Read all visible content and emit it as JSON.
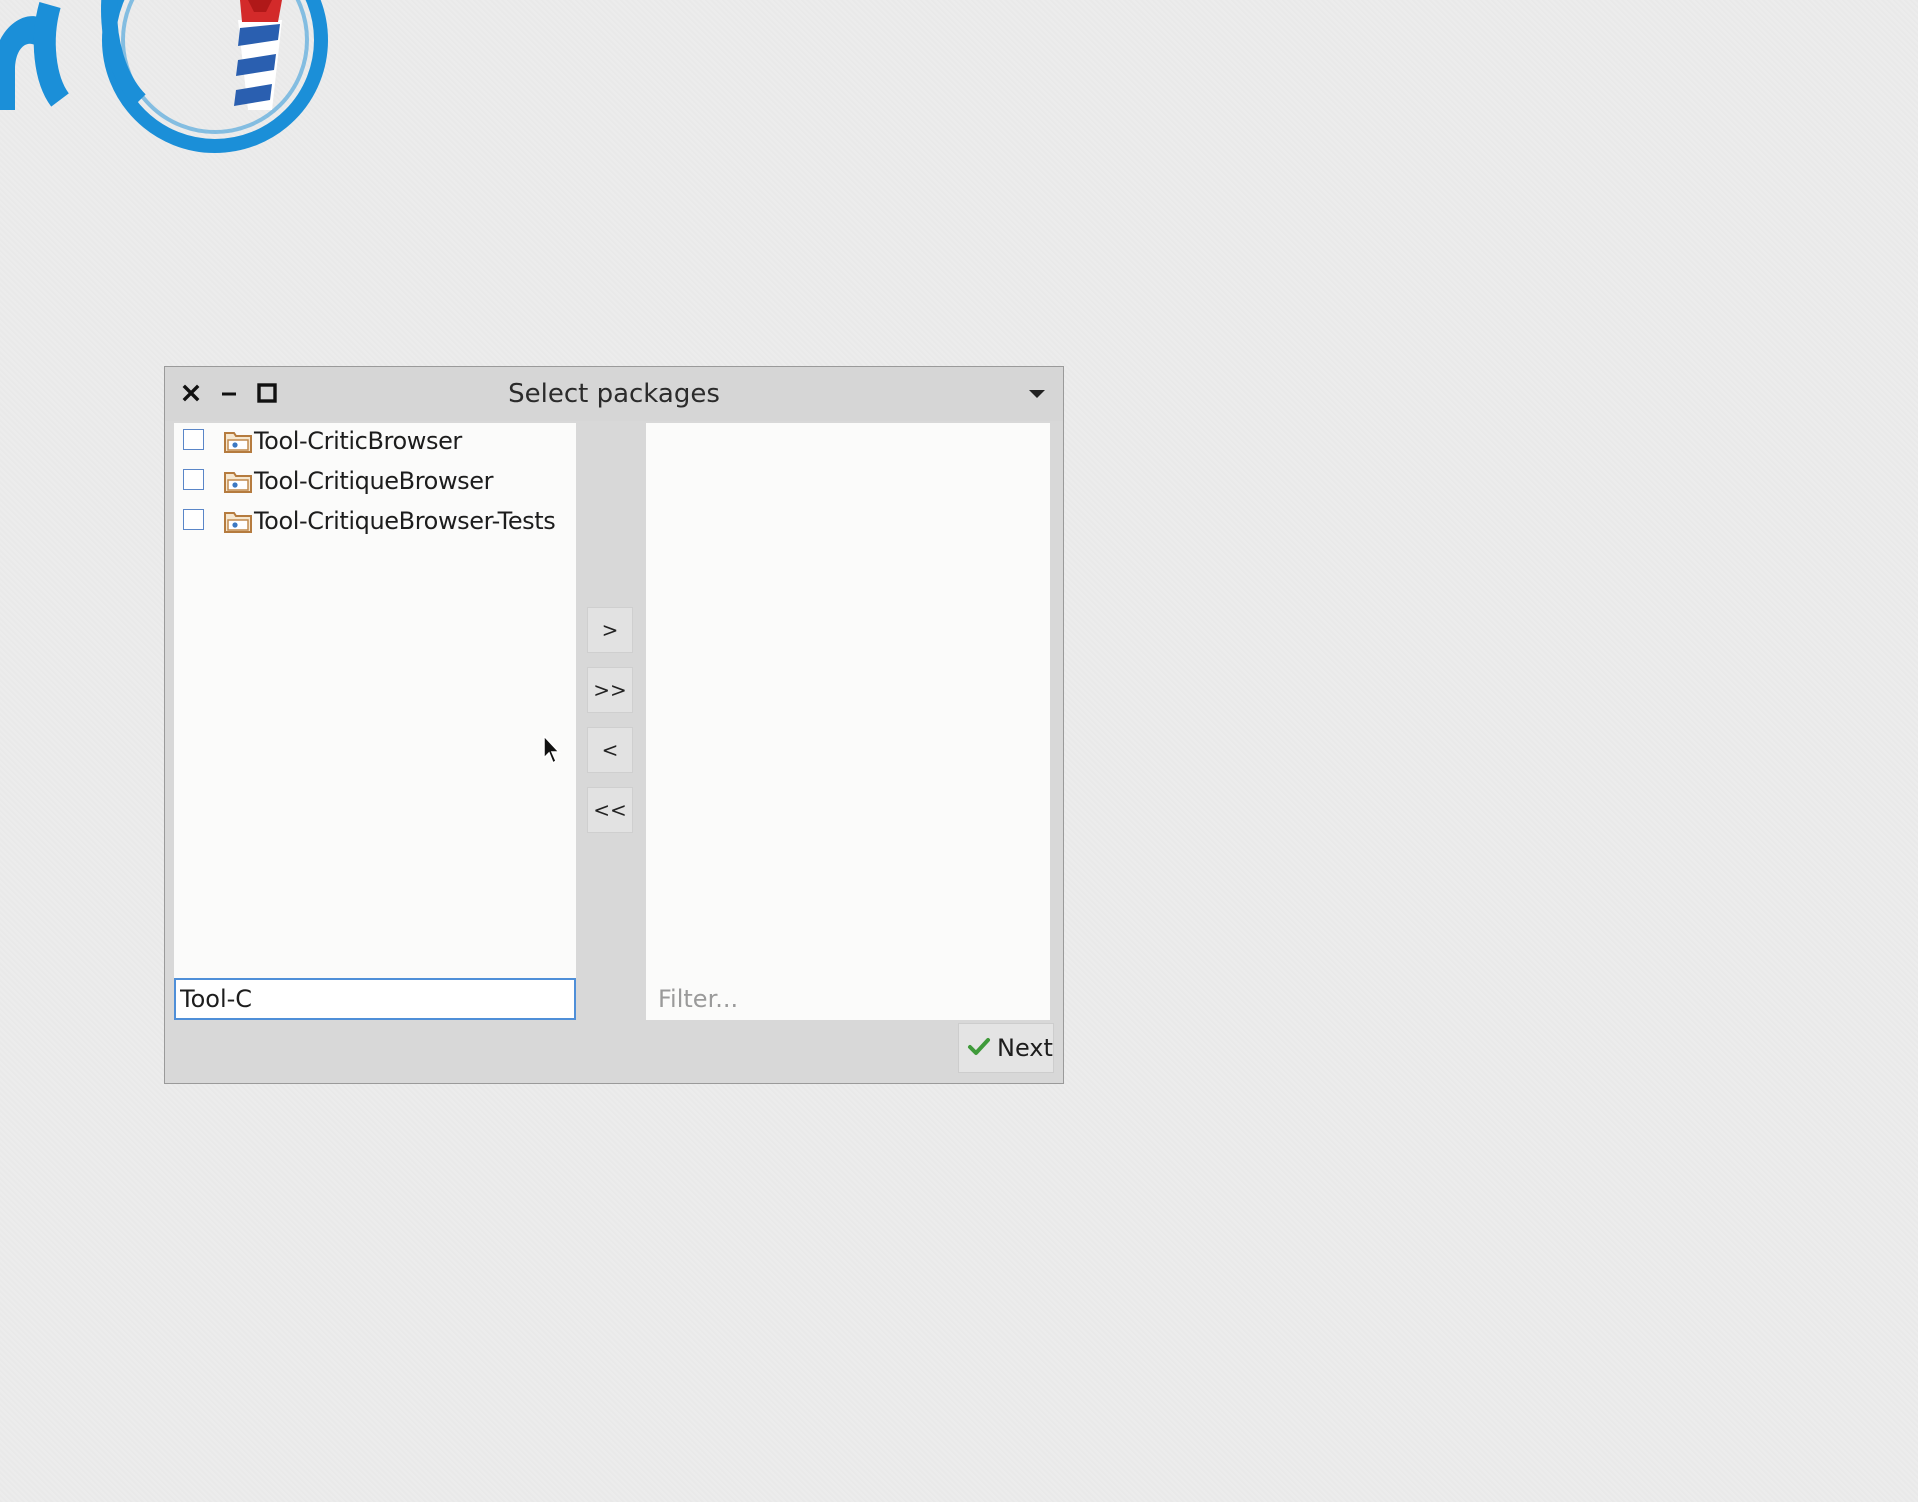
{
  "window": {
    "title": "Select packages"
  },
  "left_list": {
    "items": [
      {
        "label": "Tool-CriticBrowser",
        "checked": false
      },
      {
        "label": "Tool-CritiqueBrowser",
        "checked": false
      },
      {
        "label": "Tool-CritiqueBrowser-Tests",
        "checked": false
      }
    ],
    "filter_value": "Tool-C"
  },
  "move_buttons": {
    "add_one": ">",
    "add_all": ">>",
    "remove_one": "<",
    "remove_all": "<<"
  },
  "right_list": {
    "items": [],
    "filter_placeholder": "Filter..."
  },
  "footer": {
    "next_label": "Next"
  },
  "icons": {
    "close": "close-icon",
    "minimize": "minimize-icon",
    "maximize": "maximize-icon",
    "window_menu": "chevron-down-icon",
    "package": "package-folder-icon",
    "next": "checkmark-icon"
  },
  "colors": {
    "accent": "#4f8fd8",
    "check_green": "#3f9a3a",
    "folder": "#c08a4e"
  }
}
